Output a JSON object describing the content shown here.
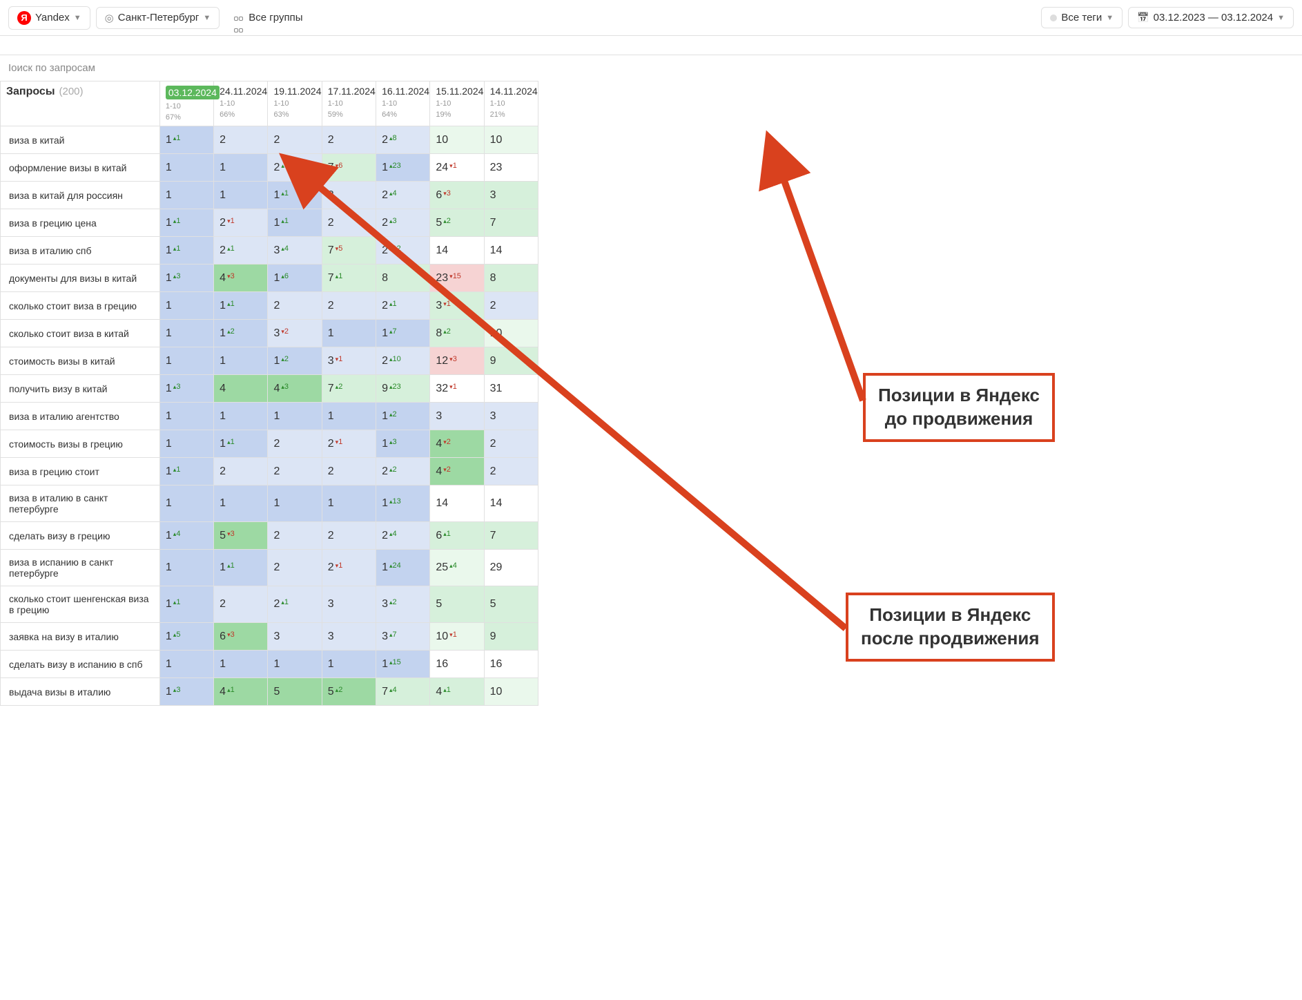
{
  "toolbar": {
    "engine": "Yandex",
    "city": "Санкт-Петербург",
    "groups": "Все группы",
    "tags": "Все теги",
    "date_range": "03.12.2023 — 03.12.2024"
  },
  "search": {
    "placeholder": "Іоиск по запросам"
  },
  "table": {
    "queries_label": "Запросы",
    "queries_count": "(200)",
    "columns": [
      {
        "date": "03.12.2024",
        "sub1": "1-10",
        "sub2": "67%",
        "active": true
      },
      {
        "date": "24.11.2024",
        "sub1": "1-10",
        "sub2": "66%"
      },
      {
        "date": "19.11.2024",
        "sub1": "1-10",
        "sub2": "63%"
      },
      {
        "date": "17.11.2024",
        "sub1": "1-10",
        "sub2": "59%"
      },
      {
        "date": "16.11.2024",
        "sub1": "1-10",
        "sub2": "64%"
      },
      {
        "date": "15.11.2024",
        "sub1": "1-10",
        "sub2": "19%"
      },
      {
        "date": "14.11.2024",
        "sub1": "1-10",
        "sub2": "21%"
      }
    ],
    "rows": [
      {
        "q": "виза в китай",
        "cells": [
          {
            "v": "1",
            "d": "+1",
            "bg": "blue"
          },
          {
            "v": "2",
            "bg": "lblue"
          },
          {
            "v": "2",
            "bg": "lblue"
          },
          {
            "v": "2",
            "bg": "lblue"
          },
          {
            "v": "2",
            "d": "+8",
            "bg": "lblue"
          },
          {
            "v": "10",
            "bg": "vlgreen"
          },
          {
            "v": "10",
            "bg": "vlgreen"
          }
        ]
      },
      {
        "q": "оформление визы в китай",
        "cells": [
          {
            "v": "1",
            "bg": "blue"
          },
          {
            "v": "1",
            "bg": "blue"
          },
          {
            "v": "2",
            "d": "+5",
            "bg": "lblue"
          },
          {
            "v": "7",
            "d": "-6",
            "bg": "lgreen"
          },
          {
            "v": "1",
            "d": "+23",
            "bg": "blue"
          },
          {
            "v": "24",
            "d": "-1",
            "bg": "white"
          },
          {
            "v": "23",
            "bg": "white"
          }
        ]
      },
      {
        "q": "виза в китай для россиян",
        "cells": [
          {
            "v": "1",
            "bg": "blue"
          },
          {
            "v": "1",
            "bg": "blue"
          },
          {
            "v": "1",
            "d": "+1",
            "bg": "blue"
          },
          {
            "v": "2",
            "bg": "lblue"
          },
          {
            "v": "2",
            "d": "+4",
            "bg": "lblue"
          },
          {
            "v": "6",
            "d": "-3",
            "bg": "lgreen"
          },
          {
            "v": "3",
            "bg": "lgreen"
          }
        ]
      },
      {
        "q": "виза в грецию цена",
        "cells": [
          {
            "v": "1",
            "d": "+1",
            "bg": "blue"
          },
          {
            "v": "2",
            "d": "-1",
            "bg": "lblue"
          },
          {
            "v": "1",
            "d": "+1",
            "bg": "blue"
          },
          {
            "v": "2",
            "bg": "lblue"
          },
          {
            "v": "2",
            "d": "+3",
            "bg": "lblue"
          },
          {
            "v": "5",
            "d": "+2",
            "bg": "lgreen"
          },
          {
            "v": "7",
            "bg": "lgreen"
          }
        ]
      },
      {
        "q": "виза в италию спб",
        "cells": [
          {
            "v": "1",
            "d": "+1",
            "bg": "blue"
          },
          {
            "v": "2",
            "d": "+1",
            "bg": "lblue"
          },
          {
            "v": "3",
            "d": "+4",
            "bg": "lblue"
          },
          {
            "v": "7",
            "d": "-5",
            "bg": "lgreen"
          },
          {
            "v": "2",
            "d": "+12",
            "bg": "lblue"
          },
          {
            "v": "14",
            "bg": "white"
          },
          {
            "v": "14",
            "bg": "white"
          }
        ]
      },
      {
        "q": "документы для визы в китай",
        "cells": [
          {
            "v": "1",
            "d": "+3",
            "bg": "blue"
          },
          {
            "v": "4",
            "d": "-3",
            "bg": "green"
          },
          {
            "v": "1",
            "d": "+6",
            "bg": "blue"
          },
          {
            "v": "7",
            "d": "+1",
            "bg": "lgreen"
          },
          {
            "v": "8",
            "bg": "lgreen"
          },
          {
            "v": "23",
            "d": "-15",
            "bg": "pink"
          },
          {
            "v": "8",
            "bg": "lgreen"
          }
        ]
      },
      {
        "q": "сколько стоит виза в грецию",
        "cells": [
          {
            "v": "1",
            "bg": "blue"
          },
          {
            "v": "1",
            "d": "+1",
            "bg": "blue"
          },
          {
            "v": "2",
            "bg": "lblue"
          },
          {
            "v": "2",
            "bg": "lblue"
          },
          {
            "v": "2",
            "d": "+1",
            "bg": "lblue"
          },
          {
            "v": "3",
            "d": "-1",
            "bg": "lgreen"
          },
          {
            "v": "2",
            "bg": "lblue"
          }
        ]
      },
      {
        "q": "сколько стоит виза в китай",
        "cells": [
          {
            "v": "1",
            "bg": "blue"
          },
          {
            "v": "1",
            "d": "+2",
            "bg": "blue"
          },
          {
            "v": "3",
            "d": "-2",
            "bg": "lblue"
          },
          {
            "v": "1",
            "bg": "blue"
          },
          {
            "v": "1",
            "d": "+7",
            "bg": "blue"
          },
          {
            "v": "8",
            "d": "+2",
            "bg": "lgreen"
          },
          {
            "v": "10",
            "bg": "vlgreen"
          }
        ]
      },
      {
        "q": "стоимость визы в китай",
        "cells": [
          {
            "v": "1",
            "bg": "blue"
          },
          {
            "v": "1",
            "bg": "blue"
          },
          {
            "v": "1",
            "d": "+2",
            "bg": "blue"
          },
          {
            "v": "3",
            "d": "-1",
            "bg": "lblue"
          },
          {
            "v": "2",
            "d": "+10",
            "bg": "lblue"
          },
          {
            "v": "12",
            "d": "-3",
            "bg": "pink"
          },
          {
            "v": "9",
            "bg": "lgreen"
          }
        ]
      },
      {
        "q": "получить визу в китай",
        "cells": [
          {
            "v": "1",
            "d": "+3",
            "bg": "blue"
          },
          {
            "v": "4",
            "bg": "green"
          },
          {
            "v": "4",
            "d": "+3",
            "bg": "green"
          },
          {
            "v": "7",
            "d": "+2",
            "bg": "lgreen"
          },
          {
            "v": "9",
            "d": "+23",
            "bg": "lgreen"
          },
          {
            "v": "32",
            "d": "-1",
            "bg": "white"
          },
          {
            "v": "31",
            "bg": "white"
          }
        ]
      },
      {
        "q": "виза в италию агентство",
        "cells": [
          {
            "v": "1",
            "bg": "blue"
          },
          {
            "v": "1",
            "bg": "blue"
          },
          {
            "v": "1",
            "bg": "blue"
          },
          {
            "v": "1",
            "bg": "blue"
          },
          {
            "v": "1",
            "d": "+2",
            "bg": "blue"
          },
          {
            "v": "3",
            "bg": "lblue"
          },
          {
            "v": "3",
            "bg": "lblue"
          }
        ]
      },
      {
        "q": "стоимость визы в грецию",
        "cells": [
          {
            "v": "1",
            "bg": "blue"
          },
          {
            "v": "1",
            "d": "+1",
            "bg": "blue"
          },
          {
            "v": "2",
            "bg": "lblue"
          },
          {
            "v": "2",
            "d": "-1",
            "bg": "lblue"
          },
          {
            "v": "1",
            "d": "+3",
            "bg": "blue"
          },
          {
            "v": "4",
            "d": "-2",
            "bg": "green"
          },
          {
            "v": "2",
            "bg": "lblue"
          }
        ]
      },
      {
        "q": "виза в грецию стоит",
        "cells": [
          {
            "v": "1",
            "d": "+1",
            "bg": "blue"
          },
          {
            "v": "2",
            "bg": "lblue"
          },
          {
            "v": "2",
            "bg": "lblue"
          },
          {
            "v": "2",
            "bg": "lblue"
          },
          {
            "v": "2",
            "d": "+2",
            "bg": "lblue"
          },
          {
            "v": "4",
            "d": "-2",
            "bg": "green"
          },
          {
            "v": "2",
            "bg": "lblue"
          }
        ]
      },
      {
        "q": "виза в италию в санкт петербурге",
        "cells": [
          {
            "v": "1",
            "bg": "blue"
          },
          {
            "v": "1",
            "bg": "blue"
          },
          {
            "v": "1",
            "bg": "blue"
          },
          {
            "v": "1",
            "bg": "blue"
          },
          {
            "v": "1",
            "d": "+13",
            "bg": "blue"
          },
          {
            "v": "14",
            "bg": "white"
          },
          {
            "v": "14",
            "bg": "white"
          }
        ]
      },
      {
        "q": "сделать визу в грецию",
        "cells": [
          {
            "v": "1",
            "d": "+4",
            "bg": "blue"
          },
          {
            "v": "5",
            "d": "-3",
            "bg": "green"
          },
          {
            "v": "2",
            "bg": "lblue"
          },
          {
            "v": "2",
            "bg": "lblue"
          },
          {
            "v": "2",
            "d": "+4",
            "bg": "lblue"
          },
          {
            "v": "6",
            "d": "+1",
            "bg": "lgreen"
          },
          {
            "v": "7",
            "bg": "lgreen"
          }
        ]
      },
      {
        "q": "виза в испанию в санкт петербурге",
        "cells": [
          {
            "v": "1",
            "bg": "blue"
          },
          {
            "v": "1",
            "d": "+1",
            "bg": "blue"
          },
          {
            "v": "2",
            "bg": "lblue"
          },
          {
            "v": "2",
            "d": "-1",
            "bg": "lblue"
          },
          {
            "v": "1",
            "d": "+24",
            "bg": "blue"
          },
          {
            "v": "25",
            "d": "+4",
            "bg": "vlgreen"
          },
          {
            "v": "29",
            "bg": "white"
          }
        ]
      },
      {
        "q": "сколько стоит шенгенская виза в грецию",
        "cells": [
          {
            "v": "1",
            "d": "+1",
            "bg": "blue"
          },
          {
            "v": "2",
            "bg": "lblue"
          },
          {
            "v": "2",
            "d": "+1",
            "bg": "lblue"
          },
          {
            "v": "3",
            "bg": "lblue"
          },
          {
            "v": "3",
            "d": "+2",
            "bg": "lblue"
          },
          {
            "v": "5",
            "bg": "lgreen"
          },
          {
            "v": "5",
            "bg": "lgreen"
          }
        ]
      },
      {
        "q": "заявка на визу в италию",
        "cells": [
          {
            "v": "1",
            "d": "+5",
            "bg": "blue"
          },
          {
            "v": "6",
            "d": "-3",
            "bg": "green"
          },
          {
            "v": "3",
            "bg": "lblue"
          },
          {
            "v": "3",
            "bg": "lblue"
          },
          {
            "v": "3",
            "d": "+7",
            "bg": "lblue"
          },
          {
            "v": "10",
            "d": "-1",
            "bg": "vlgreen"
          },
          {
            "v": "9",
            "bg": "lgreen"
          }
        ]
      },
      {
        "q": "сделать визу в испанию в спб",
        "cells": [
          {
            "v": "1",
            "bg": "blue"
          },
          {
            "v": "1",
            "bg": "blue"
          },
          {
            "v": "1",
            "bg": "blue"
          },
          {
            "v": "1",
            "bg": "blue"
          },
          {
            "v": "1",
            "d": "+15",
            "bg": "blue"
          },
          {
            "v": "16",
            "bg": "white"
          },
          {
            "v": "16",
            "bg": "white"
          }
        ]
      },
      {
        "q": "выдача визы в италию",
        "cells": [
          {
            "v": "1",
            "d": "+3",
            "bg": "blue"
          },
          {
            "v": "4",
            "d": "+1",
            "bg": "green"
          },
          {
            "v": "5",
            "bg": "green"
          },
          {
            "v": "5",
            "d": "+2",
            "bg": "green"
          },
          {
            "v": "7",
            "d": "+4",
            "bg": "lgreen"
          },
          {
            "v": "4",
            "d": "+1",
            "bg": "lgreen"
          },
          {
            "v": "10",
            "bg": "vlgreen"
          }
        ]
      }
    ]
  },
  "annotations": {
    "before": "Позиции в Яндекс\nдо продвижения",
    "after": "Позиции в Яндекс\nпосле продвижения"
  }
}
